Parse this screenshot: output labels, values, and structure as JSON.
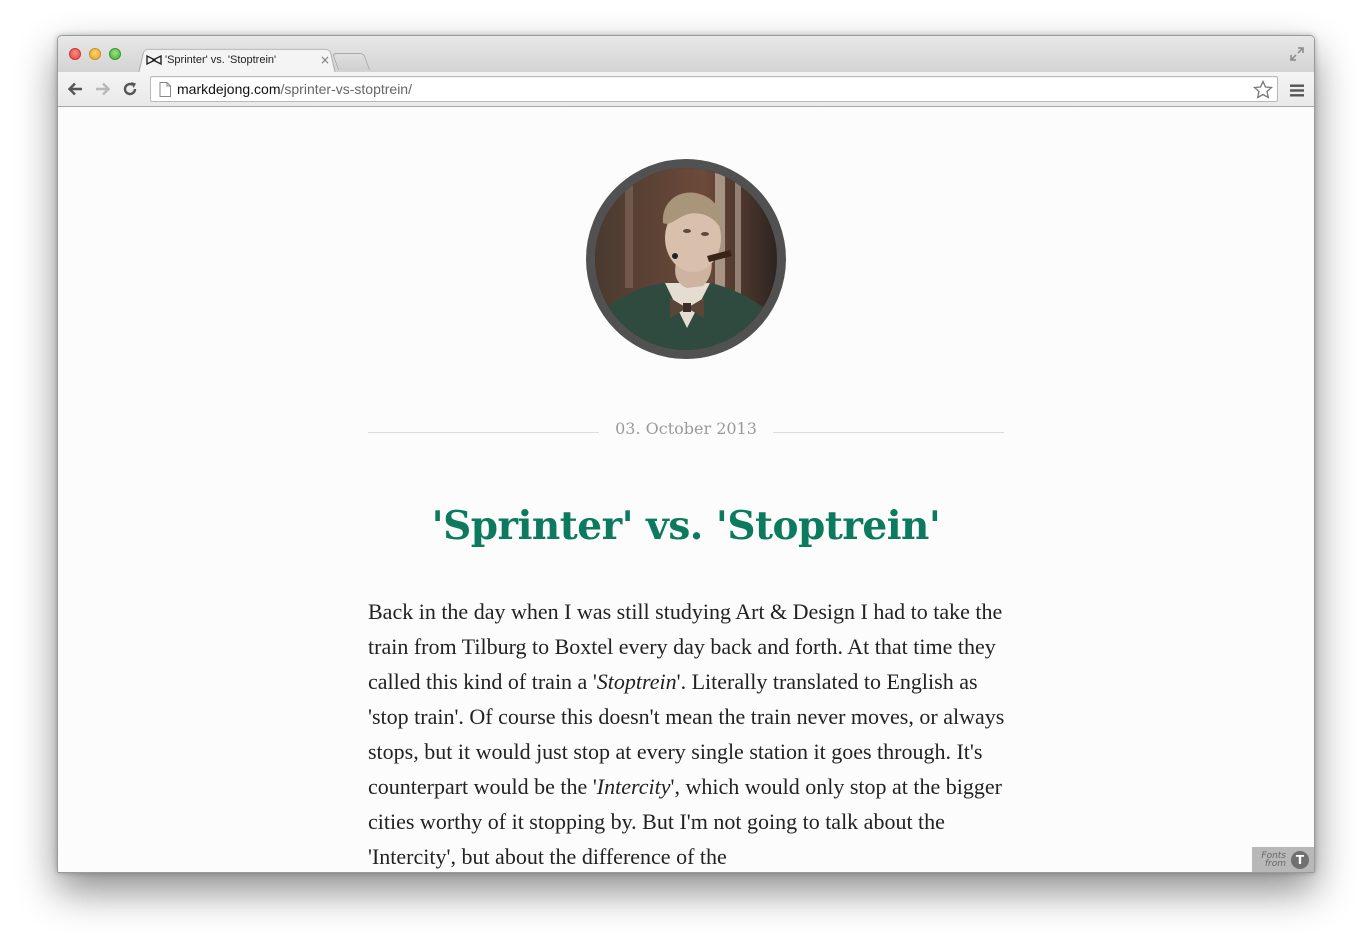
{
  "browser": {
    "tab": {
      "title": "'Sprinter' vs. 'Stoptrein'",
      "close": "×",
      "favicon": "bowtie-icon"
    },
    "url": {
      "host": "markdejong.com",
      "path": "/sprinter-vs-stoptrein/"
    },
    "icons": [
      "back-arrow-icon",
      "forward-arrow-icon",
      "reload-icon",
      "page-icon",
      "star-icon",
      "menu-icon",
      "fullscreen-icon"
    ]
  },
  "post": {
    "date": "03. October 2013",
    "title": "'Sprinter' vs. 'Stoptrein'",
    "body": [
      {
        "text": "Back in the day when I was still studying Art & Design I had to take the train from Tilburg to Boxtel every day back and forth. At that time they called this kind of train a '"
      },
      {
        "text": "Stoptrein",
        "italic": true
      },
      {
        "text": "'. Literally translated to English as 'stop train'. Of course this doesn't mean the train never moves, or always stops, but it would just stop at every single station it goes through. It's counterpart would be the '"
      },
      {
        "text": "Intercity",
        "italic": true
      },
      {
        "text": "', which would only stop at the bigger cities worthy of it stopping by. But I'm not going to talk about the 'Intercity', but about the difference of the"
      }
    ]
  },
  "badge": {
    "line1": "Fonts",
    "line2": "from",
    "logo": "T"
  },
  "colors": {
    "title": "#0c7a5d",
    "date": "#9a9a9a",
    "body": "#222222",
    "avatar_ring": "#515151"
  }
}
